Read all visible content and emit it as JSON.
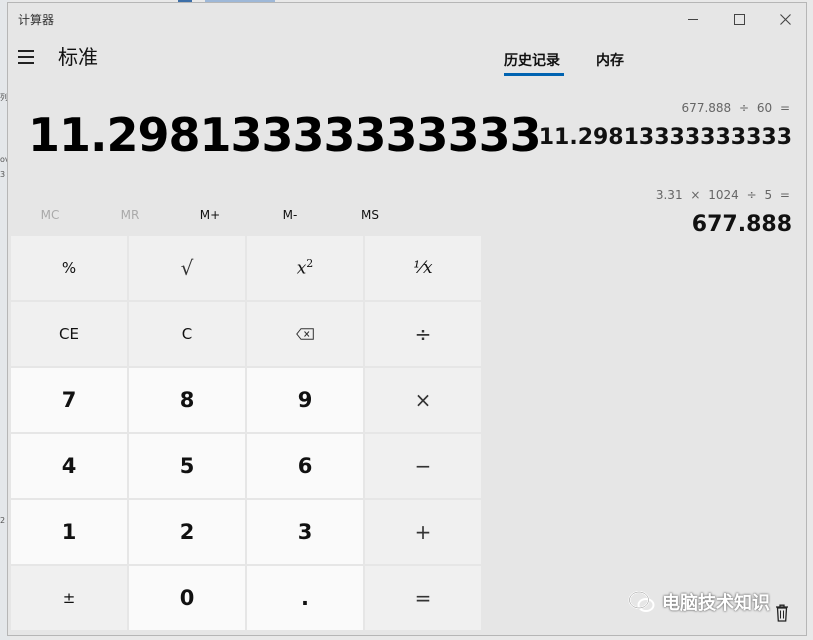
{
  "window": {
    "title": "计算器"
  },
  "header": {
    "mode": "标准"
  },
  "tabs": [
    {
      "label": "历史记录",
      "active": true
    },
    {
      "label": "内存",
      "active": false
    }
  ],
  "display": {
    "value": "11.29813333333333"
  },
  "memory": {
    "mc": "MC",
    "mr": "MR",
    "mplus": "M+",
    "mminus": "M-",
    "ms": "MS"
  },
  "keys": {
    "percent": "%",
    "sqrt": "√",
    "reciprocal": "¹⁄x",
    "ce": "CE",
    "c": "C",
    "divide": "÷",
    "k7": "7",
    "k8": "8",
    "k9": "9",
    "multiply": "×",
    "k4": "4",
    "k5": "5",
    "k6": "6",
    "minus": "−",
    "k1": "1",
    "k2": "2",
    "k3": "3",
    "plus": "+",
    "negate": "±",
    "k0": "0",
    "dot": ".",
    "equals": "="
  },
  "history": [
    {
      "expression": "677.888 ÷ 60 =",
      "result": "11.29813333333333"
    },
    {
      "expression": "3.31 × 1024 ÷ 5 =",
      "result": "677.888"
    }
  ],
  "watermark": {
    "text": "电脑技术知识"
  },
  "background_fragments": [
    "列",
    "ov",
    "3",
    "2"
  ]
}
